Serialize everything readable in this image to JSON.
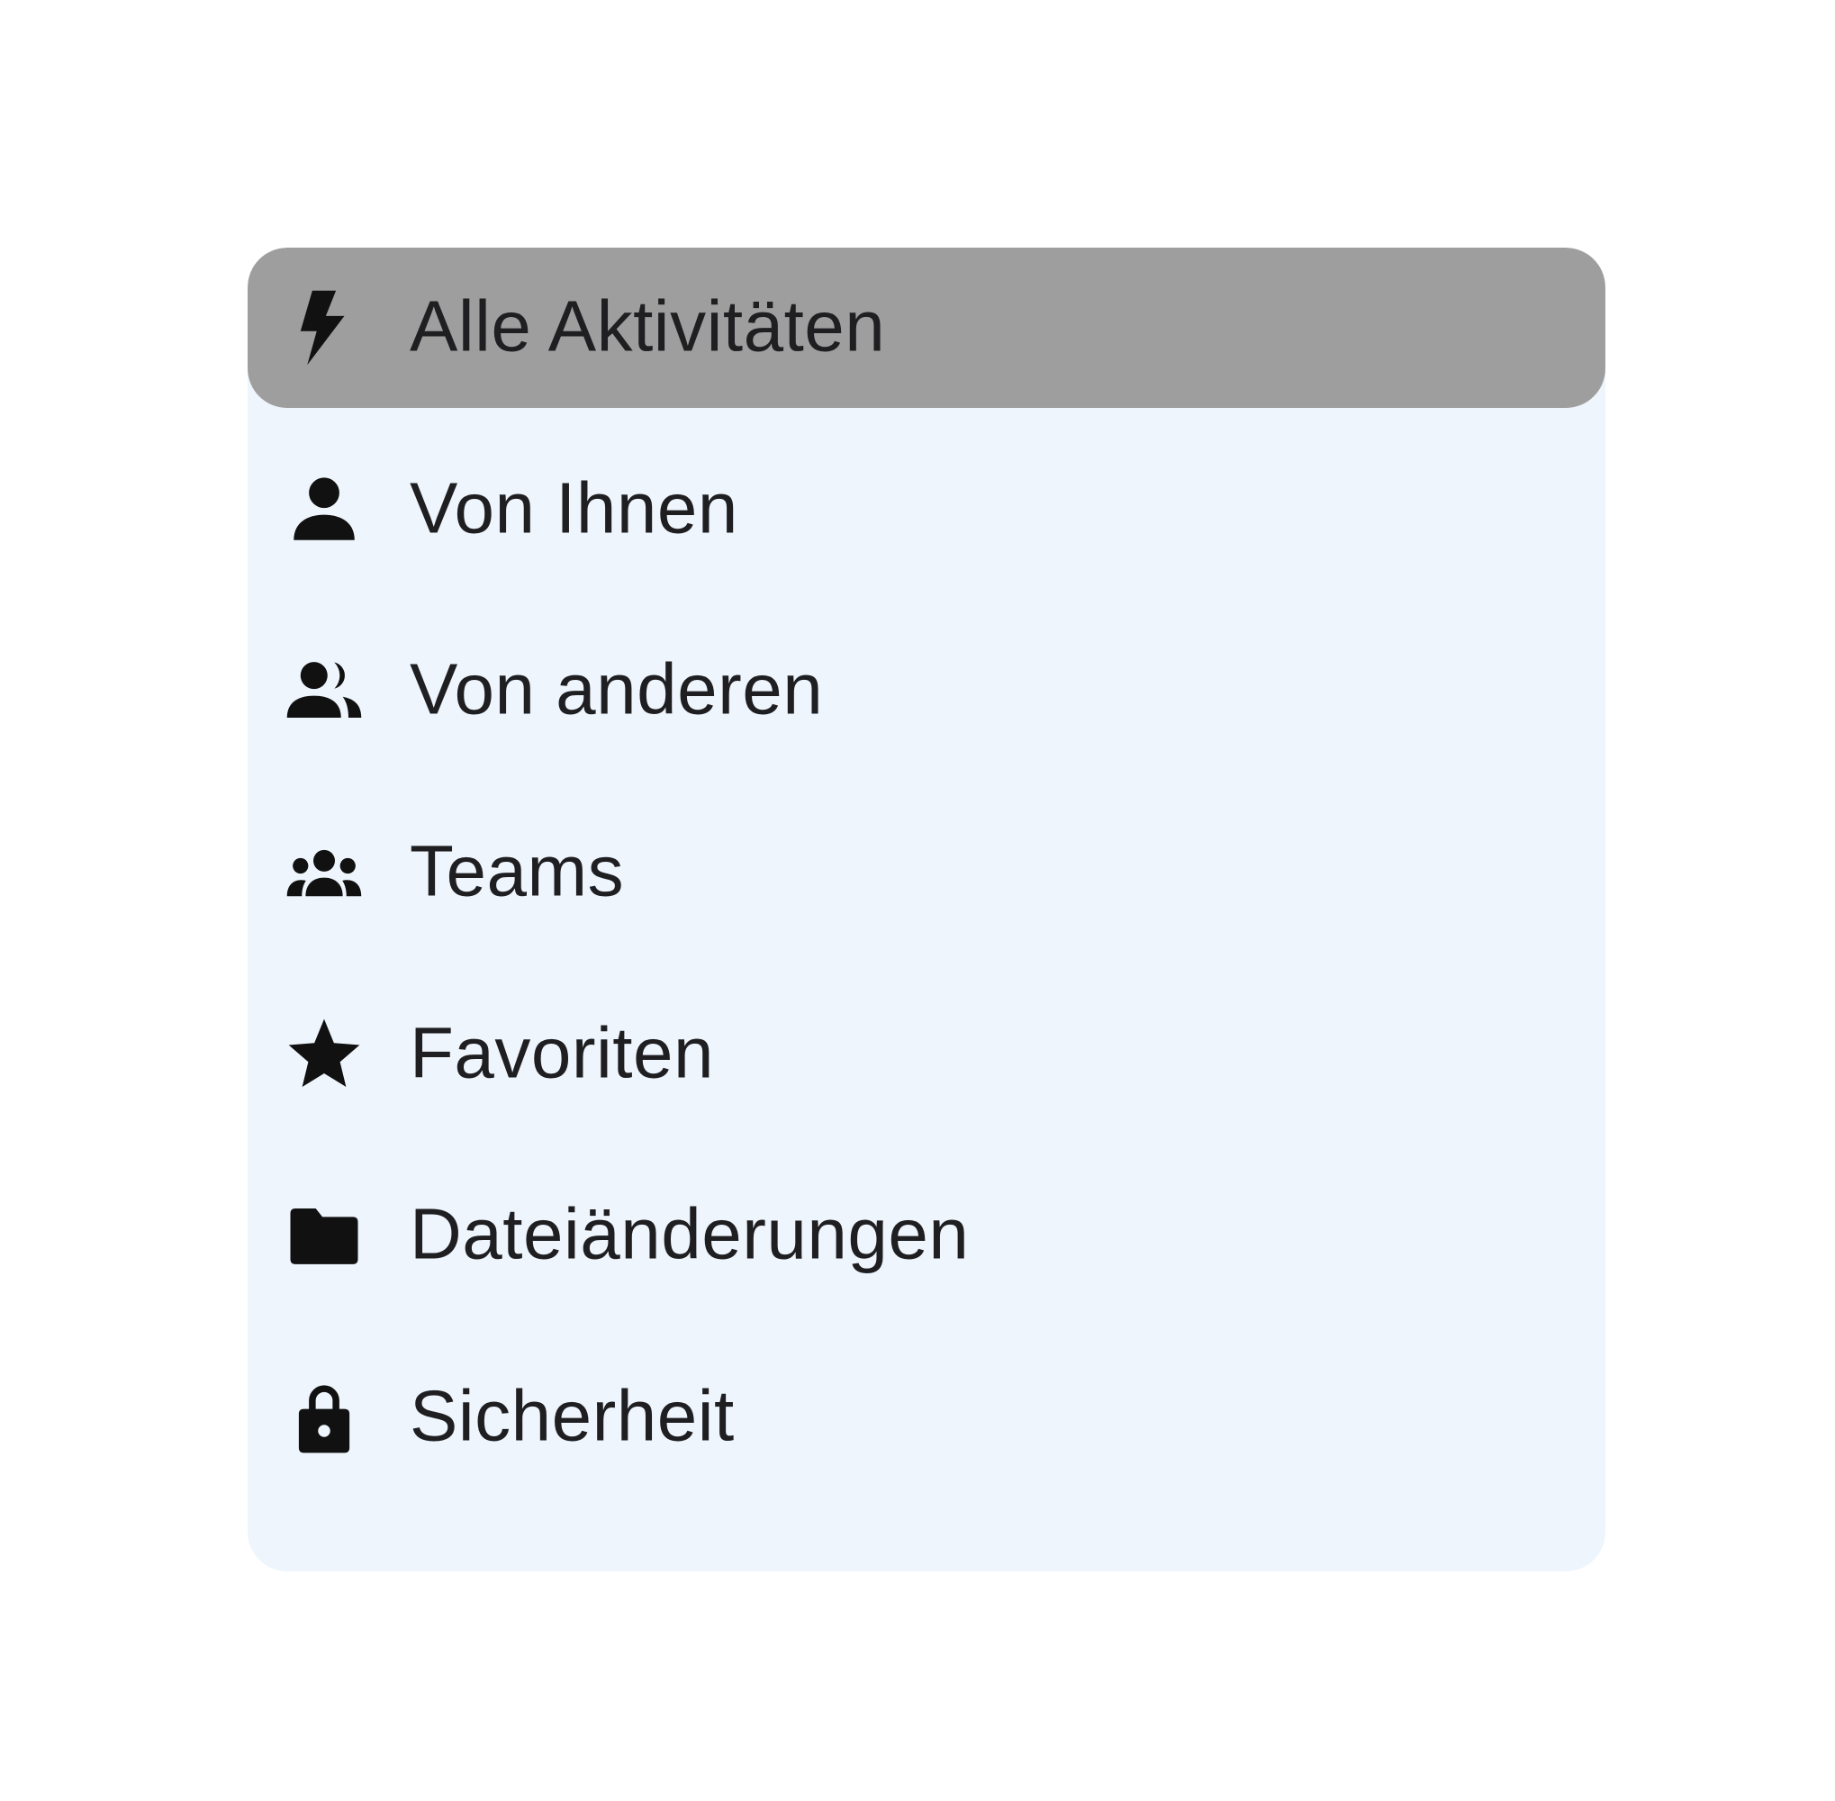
{
  "menu": {
    "items": [
      {
        "label": "Alle Aktivitäten",
        "icon": "lightning-icon",
        "selected": true
      },
      {
        "label": "Von Ihnen",
        "icon": "person-icon",
        "selected": false
      },
      {
        "label": "Von anderen",
        "icon": "people-icon",
        "selected": false
      },
      {
        "label": "Teams",
        "icon": "groups-icon",
        "selected": false
      },
      {
        "label": "Favoriten",
        "icon": "star-icon",
        "selected": false
      },
      {
        "label": "Dateiänderungen",
        "icon": "folder-icon",
        "selected": false
      },
      {
        "label": "Sicherheit",
        "icon": "lock-icon",
        "selected": false
      }
    ]
  },
  "colors": {
    "panel_background": "#eef5fd",
    "selected_background": "#9e9e9e",
    "text": "#1f1f22",
    "icon": "#111111"
  }
}
